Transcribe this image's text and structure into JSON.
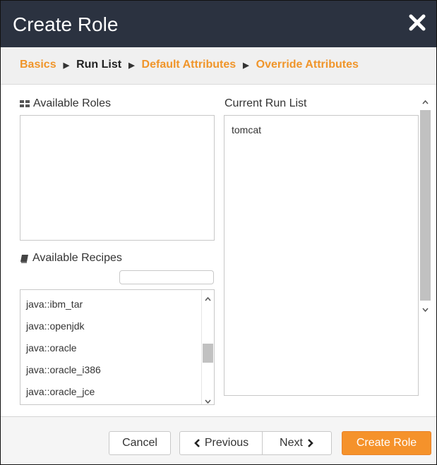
{
  "dialog": {
    "title": "Create Role"
  },
  "breadcrumbs": {
    "basics": "Basics",
    "run_list": "Run List",
    "default_attributes": "Default Attributes",
    "override_attributes": "Override Attributes"
  },
  "available_roles": {
    "label": "Available Roles",
    "items": []
  },
  "current_run_list": {
    "label": "Current Run List",
    "items": [
      "tomcat"
    ]
  },
  "available_recipes": {
    "label": "Available Recipes",
    "filter_value": "",
    "items": [
      "java::ibm_tar",
      "java::openjdk",
      "java::oracle",
      "java::oracle_i386",
      "java::oracle_jce"
    ]
  },
  "footer": {
    "cancel": "Cancel",
    "previous": "Previous",
    "next": "Next",
    "create": "Create Role"
  },
  "colors": {
    "header_bg": "#2b3240",
    "accent": "#f5922b",
    "link": "#f0952a"
  },
  "icons": {
    "close": "close-icon",
    "roles": "grid-icon",
    "recipes": "book-icon",
    "previous": "chevron-left-icon",
    "next": "chevron-right-icon"
  }
}
